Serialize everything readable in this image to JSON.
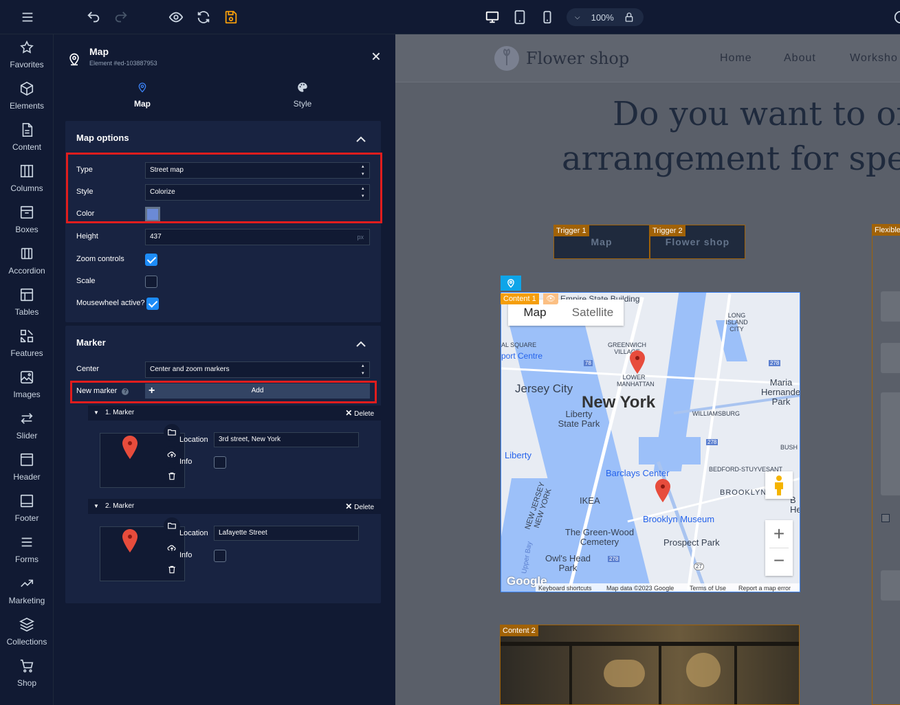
{
  "toolbar": {
    "zoom": "100%",
    "icons": [
      "menu-icon",
      "undo-icon",
      "redo-icon",
      "preview-eye-icon",
      "refresh-icon",
      "save-icon",
      "desktop-icon",
      "tablet-icon",
      "mobile-icon",
      "lock-icon",
      "settings-icon"
    ],
    "save_color": "#f59e0b"
  },
  "rail": [
    {
      "label": "Favorites",
      "icon": "star-icon"
    },
    {
      "label": "Elements",
      "icon": "cube-icon"
    },
    {
      "label": "Content",
      "icon": "document-icon"
    },
    {
      "label": "Columns",
      "icon": "columns-icon"
    },
    {
      "label": "Boxes",
      "icon": "box-icon"
    },
    {
      "label": "Accordion",
      "icon": "accordion-icon"
    },
    {
      "label": "Tables",
      "icon": "table-icon"
    },
    {
      "label": "Features",
      "icon": "features-icon"
    },
    {
      "label": "Images",
      "icon": "image-icon"
    },
    {
      "label": "Slider",
      "icon": "slider-icon"
    },
    {
      "label": "Header",
      "icon": "header-icon"
    },
    {
      "label": "Footer",
      "icon": "footer-icon"
    },
    {
      "label": "Forms",
      "icon": "forms-icon"
    },
    {
      "label": "Marketing",
      "icon": "trend-icon"
    },
    {
      "label": "Collections",
      "icon": "layers-icon"
    },
    {
      "label": "Shop",
      "icon": "cart-icon"
    }
  ],
  "panel": {
    "title": "Map",
    "subtitle": "Element #ed-103887953",
    "tabs": [
      {
        "label": "Map"
      },
      {
        "label": "Style"
      }
    ],
    "map_options": {
      "title": "Map options",
      "type_label": "Type",
      "type_value": "Street map",
      "style_label": "Style",
      "style_value": "Colorize",
      "color_label": "Color",
      "color_value": "#6b8ad6",
      "height_label": "Height",
      "height_value": "437",
      "height_unit": "px",
      "zoom_label": "Zoom controls",
      "zoom_on": true,
      "scale_label": "Scale",
      "scale_on": false,
      "wheel_label": "Mousewheel active?",
      "wheel_on": true
    },
    "marker": {
      "title": "Marker",
      "center_label": "Center",
      "center_value": "Center and zoom markers",
      "new_label": "New marker",
      "add_label": "Add",
      "delete_label": "Delete",
      "location_label": "Location",
      "info_label": "Info",
      "items": [
        {
          "title": "1. Marker",
          "location": "3rd street, New York"
        },
        {
          "title": "2. Marker",
          "location": "Lafayette Street"
        }
      ]
    }
  },
  "site": {
    "brand": "Flower shop",
    "nav": [
      "Home",
      "About",
      "Worksho"
    ],
    "headline_1": "Do you want to or",
    "headline_2": "arrangement for spe",
    "triggers": [
      {
        "tag": "Trigger 1",
        "label": "Map"
      },
      {
        "tag": "Trigger 2",
        "label": "Flower shop"
      }
    ],
    "flexible_tag": "Flexible",
    "content1_tag": "Content 1",
    "content2_tag": "Content 2"
  },
  "map": {
    "tab_map": "Map",
    "tab_satellite": "Satellite",
    "labels": {
      "esb": "Empire State Building",
      "lic": "LONG ISLAND CITY",
      "greenwich": "GREENWICH VILLAGE",
      "square": "AL SQUARE",
      "port": "port Centre",
      "lower": "LOWER MANHATTAN",
      "jersey": "Jersey City",
      "newyork": "New York",
      "williamsburg": "WILLIAMSBURG",
      "liberty_park": "Liberty State Park",
      "maria": "Maria Hernandez Park",
      "liberty": "Liberty",
      "bush": "BUSH",
      "bedford": "BEDFORD-STUYVESANT",
      "barclays": "Barclays Center",
      "brooklyn": "BROOKLYN",
      "ikea": "IKEA",
      "museum": "Brooklyn Museum",
      "nj": "NEW JERSEY NEW YORK",
      "greenwood": "The Green-Wood Cemetery",
      "prospect": "Prospect Park",
      "upperbay": "Upper Bay",
      "owls": "Owl's Head Park",
      "bheights": "B Hea",
      "r278a": "278",
      "r78": "78",
      "r278b": "278",
      "r278c": "278",
      "r27": "27"
    },
    "footer": {
      "google": "Google",
      "shortcuts": "Keyboard shortcuts",
      "data": "Map data ©2023 Google",
      "terms": "Terms of Use",
      "report": "Report a map error"
    }
  }
}
